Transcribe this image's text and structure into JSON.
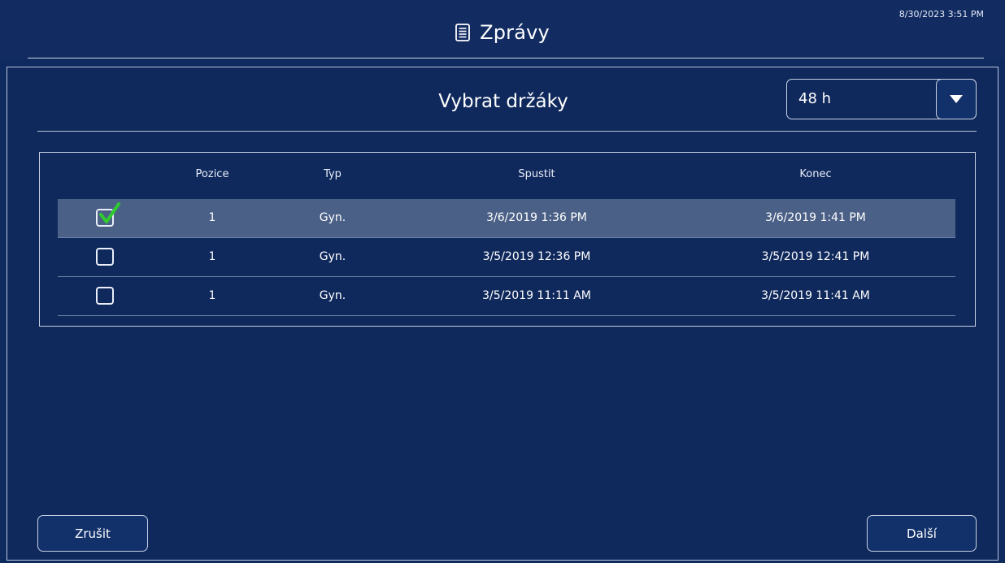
{
  "header": {
    "title": "Zprávy",
    "clock": "8/30/2023 3:51 PM",
    "icon": "document-icon"
  },
  "panel": {
    "title": "Vybrat držáky",
    "range_select": {
      "value": "48 h",
      "icon": "dropdown-triangle-icon"
    }
  },
  "table": {
    "columns": {
      "position": "Pozice",
      "type": "Typ",
      "start": "Spustit",
      "end": "Konec"
    },
    "rows": [
      {
        "checked": true,
        "position": "1",
        "type": "Gyn.",
        "start": "3/6/2019 1:36 PM",
        "end": "3/6/2019 1:41 PM"
      },
      {
        "checked": false,
        "position": "1",
        "type": "Gyn.",
        "start": "3/5/2019 12:36 PM",
        "end": "3/5/2019 12:41 PM"
      },
      {
        "checked": false,
        "position": "1",
        "type": "Gyn.",
        "start": "3/5/2019 11:11 AM",
        "end": "3/5/2019 11:41 AM"
      }
    ]
  },
  "footer": {
    "cancel_label": "Zrušit",
    "next_label": "Další"
  },
  "colors": {
    "background": "#0f2a5e",
    "selected_row": "#4b6087",
    "check": "#2ecc2e"
  }
}
